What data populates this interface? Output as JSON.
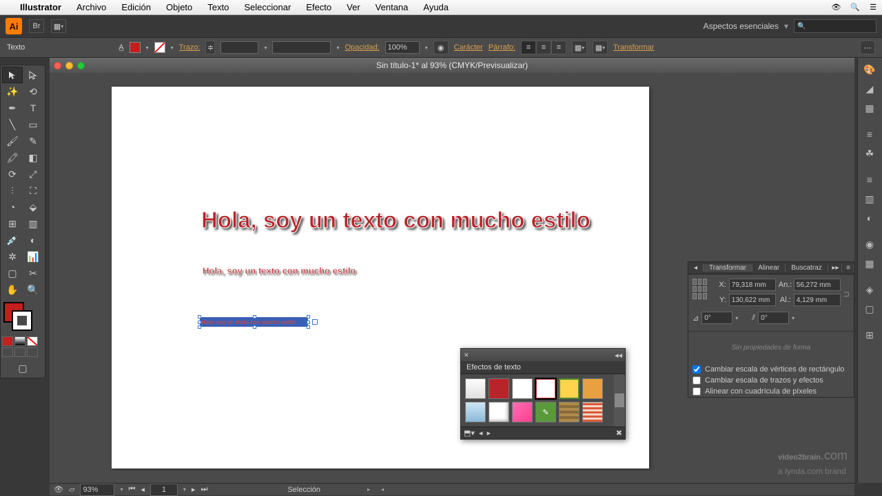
{
  "menubar": {
    "app": "Illustrator",
    "items": [
      "Archivo",
      "Edición",
      "Objeto",
      "Texto",
      "Seleccionar",
      "Efecto",
      "Ver",
      "Ventana",
      "Ayuda"
    ]
  },
  "appbar": {
    "workspace": "Aspectos esenciales"
  },
  "controlbar": {
    "context_label": "Texto",
    "trazo_label": "Trazo:",
    "opacity_label": "Opacidad:",
    "opacity_value": "100%",
    "caracter": "Carácter",
    "parrafo": "Párrafo:",
    "transformar": "Transformar"
  },
  "document": {
    "title": "Sin título-1* al 93% (CMYK/Previsualizar)",
    "zoom": "93%",
    "page": "1",
    "tool_status": "Selección"
  },
  "canvas": {
    "text1": "Hola, soy un texto con mucho estilo",
    "text2": "Hola, soy un texto con mucho estilo",
    "text3": "Hola, soy un texto con mucho estilo"
  },
  "graphic_styles": {
    "title": "Efectos de texto",
    "swatches": [
      {
        "bg": "linear-gradient(#fdfdfd,#e0e0e0)"
      },
      {
        "bg": "#b8242a"
      },
      {
        "bg": "#fff",
        "border": "#ccc"
      },
      {
        "bg": "#fff",
        "border": "#c44",
        "sel": true
      },
      {
        "bg": "#ffd34d",
        "border": "#4a8a2a"
      },
      {
        "bg": "#e8a040"
      },
      {
        "bg": "linear-gradient(#cfe6f5,#8ab8d8)"
      },
      {
        "bg": "#fff",
        "shadow": true
      },
      {
        "bg": "linear-gradient(135deg,#ff6fb5,#ff3d8e)"
      },
      {
        "bg": "#5a9a3a"
      },
      {
        "bg": "repeating-linear-gradient(#b08a4a 0 4px,#8a6a3a 4px 8px)"
      },
      {
        "bg": "repeating-linear-gradient(0deg,#d85a3a 0 3px,#fff 3px 6px)"
      }
    ]
  },
  "transform_panel": {
    "tabs": [
      "Transformar",
      "Alinear",
      "Buscatraz"
    ],
    "x_label": "X:",
    "x": "79,318 mm",
    "y_label": "Y:",
    "y": "130,622 mm",
    "w_label": "An.:",
    "w": "56,272 mm",
    "h_label": "Al.:",
    "h": "4,129 mm",
    "rot": "0°",
    "shear": "0°",
    "shape_empty": "Sin propiedades de forma",
    "chk1": "Cambiar escala de vértices de rectángulo",
    "chk2": "Cambiar escala de trazos y efectos",
    "chk3": "Alinear con cuadrícula de píxeles"
  },
  "watermark": {
    "brand": "video2brain",
    "sub": "a lynda.com brand"
  }
}
